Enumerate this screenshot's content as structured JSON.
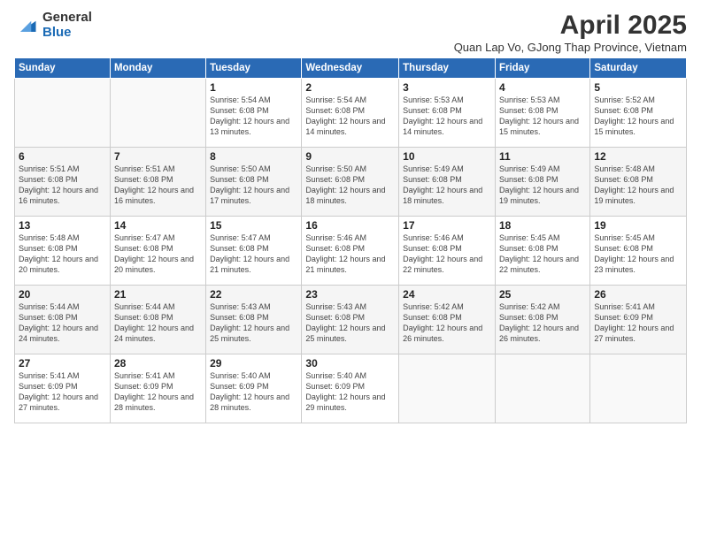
{
  "logo": {
    "general": "General",
    "blue": "Blue"
  },
  "title": "April 2025",
  "subtitle": "Quan Lap Vo, GJong Thap Province, Vietnam",
  "days_of_week": [
    "Sunday",
    "Monday",
    "Tuesday",
    "Wednesday",
    "Thursday",
    "Friday",
    "Saturday"
  ],
  "weeks": [
    [
      {
        "day": "",
        "info": ""
      },
      {
        "day": "",
        "info": ""
      },
      {
        "day": "1",
        "info": "Sunrise: 5:54 AM\nSunset: 6:08 PM\nDaylight: 12 hours and 13 minutes."
      },
      {
        "day": "2",
        "info": "Sunrise: 5:54 AM\nSunset: 6:08 PM\nDaylight: 12 hours and 14 minutes."
      },
      {
        "day": "3",
        "info": "Sunrise: 5:53 AM\nSunset: 6:08 PM\nDaylight: 12 hours and 14 minutes."
      },
      {
        "day": "4",
        "info": "Sunrise: 5:53 AM\nSunset: 6:08 PM\nDaylight: 12 hours and 15 minutes."
      },
      {
        "day": "5",
        "info": "Sunrise: 5:52 AM\nSunset: 6:08 PM\nDaylight: 12 hours and 15 minutes."
      }
    ],
    [
      {
        "day": "6",
        "info": "Sunrise: 5:51 AM\nSunset: 6:08 PM\nDaylight: 12 hours and 16 minutes."
      },
      {
        "day": "7",
        "info": "Sunrise: 5:51 AM\nSunset: 6:08 PM\nDaylight: 12 hours and 16 minutes."
      },
      {
        "day": "8",
        "info": "Sunrise: 5:50 AM\nSunset: 6:08 PM\nDaylight: 12 hours and 17 minutes."
      },
      {
        "day": "9",
        "info": "Sunrise: 5:50 AM\nSunset: 6:08 PM\nDaylight: 12 hours and 18 minutes."
      },
      {
        "day": "10",
        "info": "Sunrise: 5:49 AM\nSunset: 6:08 PM\nDaylight: 12 hours and 18 minutes."
      },
      {
        "day": "11",
        "info": "Sunrise: 5:49 AM\nSunset: 6:08 PM\nDaylight: 12 hours and 19 minutes."
      },
      {
        "day": "12",
        "info": "Sunrise: 5:48 AM\nSunset: 6:08 PM\nDaylight: 12 hours and 19 minutes."
      }
    ],
    [
      {
        "day": "13",
        "info": "Sunrise: 5:48 AM\nSunset: 6:08 PM\nDaylight: 12 hours and 20 minutes."
      },
      {
        "day": "14",
        "info": "Sunrise: 5:47 AM\nSunset: 6:08 PM\nDaylight: 12 hours and 20 minutes."
      },
      {
        "day": "15",
        "info": "Sunrise: 5:47 AM\nSunset: 6:08 PM\nDaylight: 12 hours and 21 minutes."
      },
      {
        "day": "16",
        "info": "Sunrise: 5:46 AM\nSunset: 6:08 PM\nDaylight: 12 hours and 21 minutes."
      },
      {
        "day": "17",
        "info": "Sunrise: 5:46 AM\nSunset: 6:08 PM\nDaylight: 12 hours and 22 minutes."
      },
      {
        "day": "18",
        "info": "Sunrise: 5:45 AM\nSunset: 6:08 PM\nDaylight: 12 hours and 22 minutes."
      },
      {
        "day": "19",
        "info": "Sunrise: 5:45 AM\nSunset: 6:08 PM\nDaylight: 12 hours and 23 minutes."
      }
    ],
    [
      {
        "day": "20",
        "info": "Sunrise: 5:44 AM\nSunset: 6:08 PM\nDaylight: 12 hours and 24 minutes."
      },
      {
        "day": "21",
        "info": "Sunrise: 5:44 AM\nSunset: 6:08 PM\nDaylight: 12 hours and 24 minutes."
      },
      {
        "day": "22",
        "info": "Sunrise: 5:43 AM\nSunset: 6:08 PM\nDaylight: 12 hours and 25 minutes."
      },
      {
        "day": "23",
        "info": "Sunrise: 5:43 AM\nSunset: 6:08 PM\nDaylight: 12 hours and 25 minutes."
      },
      {
        "day": "24",
        "info": "Sunrise: 5:42 AM\nSunset: 6:08 PM\nDaylight: 12 hours and 26 minutes."
      },
      {
        "day": "25",
        "info": "Sunrise: 5:42 AM\nSunset: 6:08 PM\nDaylight: 12 hours and 26 minutes."
      },
      {
        "day": "26",
        "info": "Sunrise: 5:41 AM\nSunset: 6:09 PM\nDaylight: 12 hours and 27 minutes."
      }
    ],
    [
      {
        "day": "27",
        "info": "Sunrise: 5:41 AM\nSunset: 6:09 PM\nDaylight: 12 hours and 27 minutes."
      },
      {
        "day": "28",
        "info": "Sunrise: 5:41 AM\nSunset: 6:09 PM\nDaylight: 12 hours and 28 minutes."
      },
      {
        "day": "29",
        "info": "Sunrise: 5:40 AM\nSunset: 6:09 PM\nDaylight: 12 hours and 28 minutes."
      },
      {
        "day": "30",
        "info": "Sunrise: 5:40 AM\nSunset: 6:09 PM\nDaylight: 12 hours and 29 minutes."
      },
      {
        "day": "",
        "info": ""
      },
      {
        "day": "",
        "info": ""
      },
      {
        "day": "",
        "info": ""
      }
    ]
  ]
}
